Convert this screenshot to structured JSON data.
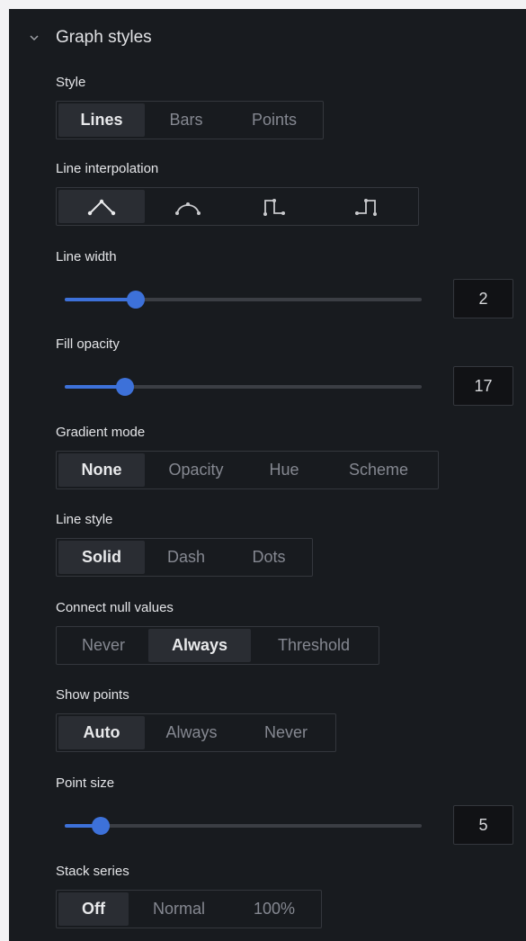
{
  "section": {
    "title": "Graph styles"
  },
  "style": {
    "label": "Style",
    "options": [
      "Lines",
      "Bars",
      "Points"
    ],
    "selected": "Lines"
  },
  "interpolation": {
    "label": "Line interpolation",
    "icons": [
      "linear-interpolation-icon",
      "smooth-interpolation-icon",
      "step-before-icon",
      "step-after-icon"
    ],
    "selected": 0
  },
  "line_width": {
    "label": "Line width",
    "value": "2",
    "fraction": 0.2
  },
  "fill_opacity": {
    "label": "Fill opacity",
    "value": "17",
    "fraction": 0.17
  },
  "gradient_mode": {
    "label": "Gradient mode",
    "options": [
      "None",
      "Opacity",
      "Hue",
      "Scheme"
    ],
    "selected": "None"
  },
  "line_style": {
    "label": "Line style",
    "options": [
      "Solid",
      "Dash",
      "Dots"
    ],
    "selected": "Solid"
  },
  "connect_nulls": {
    "label": "Connect null values",
    "options": [
      "Never",
      "Always",
      "Threshold"
    ],
    "selected": "Always"
  },
  "show_points": {
    "label": "Show points",
    "options": [
      "Auto",
      "Always",
      "Never"
    ],
    "selected": "Auto"
  },
  "point_size": {
    "label": "Point size",
    "value": "5",
    "fraction": 0.1
  },
  "stack_series": {
    "label": "Stack series",
    "options": [
      "Off",
      "Normal",
      "100%"
    ],
    "selected": "Off"
  },
  "colors": {
    "accent": "#3d71d9",
    "panel": "#181b1f",
    "active_option": "#2a2d33"
  }
}
